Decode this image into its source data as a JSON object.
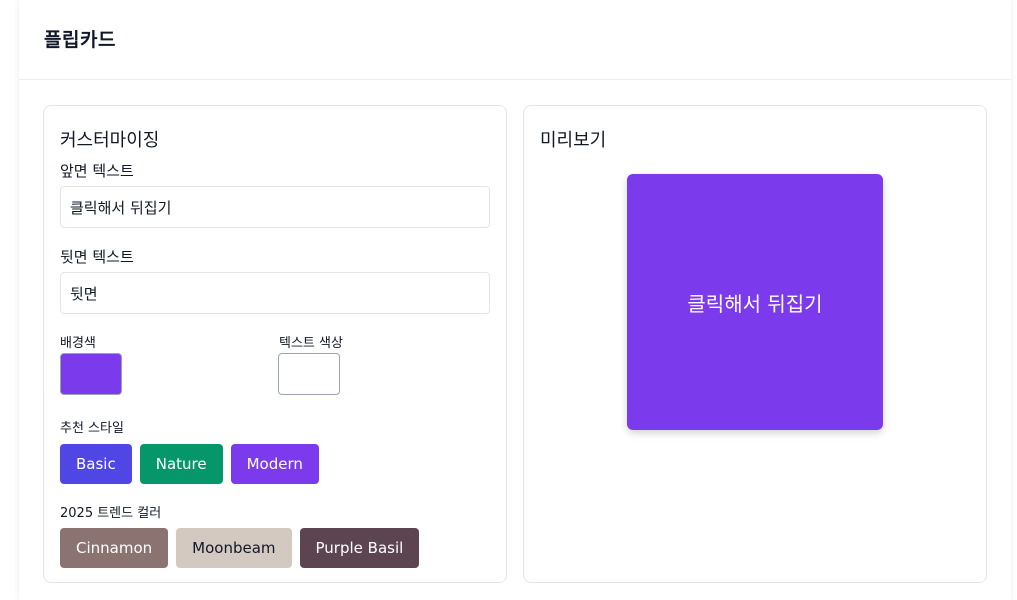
{
  "header": {
    "title": "플립카드"
  },
  "customize": {
    "title": "커스터마이징",
    "front_label": "앞면 텍스트",
    "front_value": "클릭해서 뒤집기",
    "back_label": "뒷면 텍스트",
    "back_value": "뒷면",
    "bg_label": "배경색",
    "text_color_label": "텍스트 색상",
    "bg_color": "#7c3aed",
    "text_color": "#ffffff",
    "recommended_label": "추천 스타일",
    "recommended": [
      {
        "label": "Basic",
        "bg": "#4f46e5",
        "fg": "#ffffff"
      },
      {
        "label": "Nature",
        "bg": "#059669",
        "fg": "#ffffff"
      },
      {
        "label": "Modern",
        "bg": "#7c3aed",
        "fg": "#ffffff"
      }
    ],
    "trend_label": "2025 트렌드 컬러",
    "trend": [
      {
        "label": "Cinnamon",
        "bg": "#8a7370",
        "fg": "#ffffff"
      },
      {
        "label": "Moonbeam",
        "bg": "#d4c9c1",
        "fg": "#111827"
      },
      {
        "label": "Purple Basil",
        "bg": "#5c4550",
        "fg": "#ffffff"
      }
    ]
  },
  "preview": {
    "title": "미리보기",
    "card_text": "클릭해서 뒤집기"
  }
}
